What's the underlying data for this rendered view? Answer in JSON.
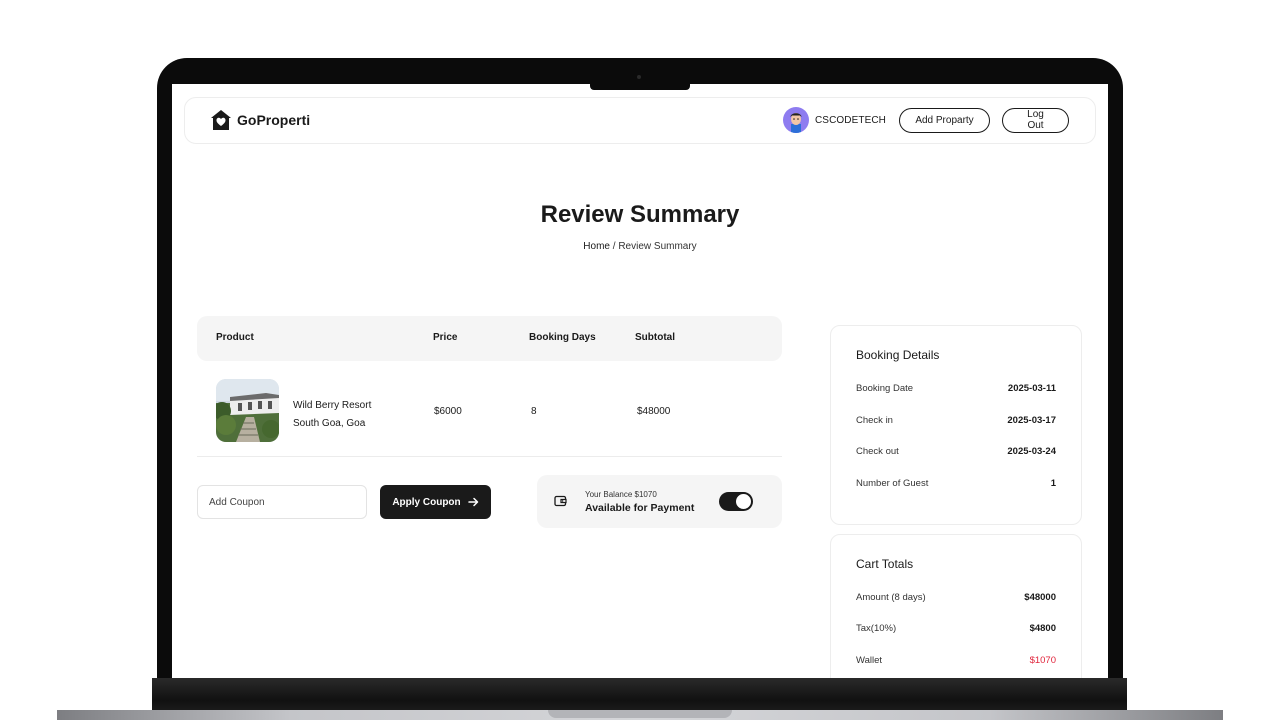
{
  "navbar": {
    "brand": "GoProperti",
    "user_name": "CSCODETECH",
    "add_property_label": "Add Proparty",
    "logout_label": "Log Out"
  },
  "page": {
    "title": "Review Summary",
    "breadcrumb": {
      "home": "Home",
      "separator": " / ",
      "current": "Review Summary"
    }
  },
  "table": {
    "headers": [
      "Product",
      "Price",
      "Booking Days",
      "Subtotal"
    ],
    "rows": [
      {
        "name": "Wild Berry Resort",
        "location": "South Goa, Goa",
        "price": "$6000",
        "days": "8",
        "subtotal": "$48000"
      }
    ]
  },
  "coupon": {
    "placeholder": "Add Coupon",
    "apply_label": "Apply Coupon"
  },
  "wallet": {
    "balance_text": "Your Balance $1070",
    "available_text": "Available for Payment",
    "toggle_on": true
  },
  "booking_details": {
    "title": "Booking Details",
    "items": [
      {
        "label": "Booking Date",
        "value": "2025-03-11"
      },
      {
        "label": "Check in",
        "value": "2025-03-17"
      },
      {
        "label": "Check out",
        "value": "2025-03-24"
      },
      {
        "label": "Number of Guest",
        "value": "1"
      }
    ]
  },
  "cart_totals": {
    "title": "Cart Totals",
    "items": [
      {
        "label": "Amount (8 days)",
        "value": "$48000"
      },
      {
        "label": "Tax(10%)",
        "value": "$4800"
      },
      {
        "label": "Wallet",
        "value": "$1070"
      }
    ]
  },
  "colors": {
    "accent_dark": "#1a1a1a",
    "wallet_red": "#e0243b",
    "panel_gray": "#f5f5f5",
    "avatar_purple": "#8e7cf0"
  }
}
